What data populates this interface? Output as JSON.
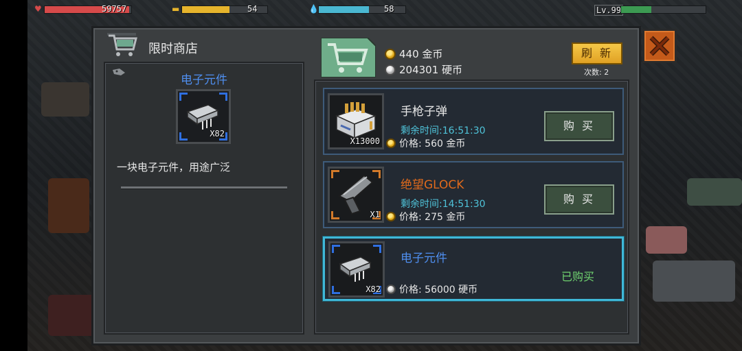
{
  "hud": {
    "hp": {
      "value": "59757",
      "fill": 0.98,
      "color": "#d64a4a"
    },
    "food": {
      "value": "54",
      "fill": 0.7,
      "color": "#e6b42c"
    },
    "water": {
      "value": "58",
      "fill": 0.72,
      "color": "#4ab7d1"
    },
    "level": {
      "label": "Lv.99",
      "fill": 0.5,
      "color": "#3c9a52"
    }
  },
  "shop": {
    "title": "限时商店",
    "gold_amount": "440 金币",
    "silver_amount": "204301 硬币",
    "refresh_label": "刷 新",
    "refresh_count": "次数: 2"
  },
  "detail": {
    "name": "电子元件",
    "quantity": "X82",
    "description": "一块电子元件，用途广泛"
  },
  "items": [
    {
      "name": "手枪子弹",
      "name_color": "#e8e8e8",
      "timer": "剩余时间:16:51:30",
      "price": "价格: 560 金币",
      "currency": "gold",
      "quantity": "X13000",
      "action": "购 买",
      "frame_color": "#8f9296"
    },
    {
      "name": "绝望GLOCK",
      "name_color": "#e06a1c",
      "timer": "剩余时间:14:51:30",
      "price": "价格: 275 金币",
      "currency": "gold",
      "quantity": "X1",
      "action": "购 买",
      "frame_color": "#d27a2a"
    },
    {
      "name": "电子元件",
      "name_color": "#4f8ff0",
      "timer": "",
      "price": "价格: 56000 硬币",
      "currency": "silver",
      "quantity": "X82",
      "action": "已购买",
      "frame_color": "#2f6fe0"
    }
  ]
}
